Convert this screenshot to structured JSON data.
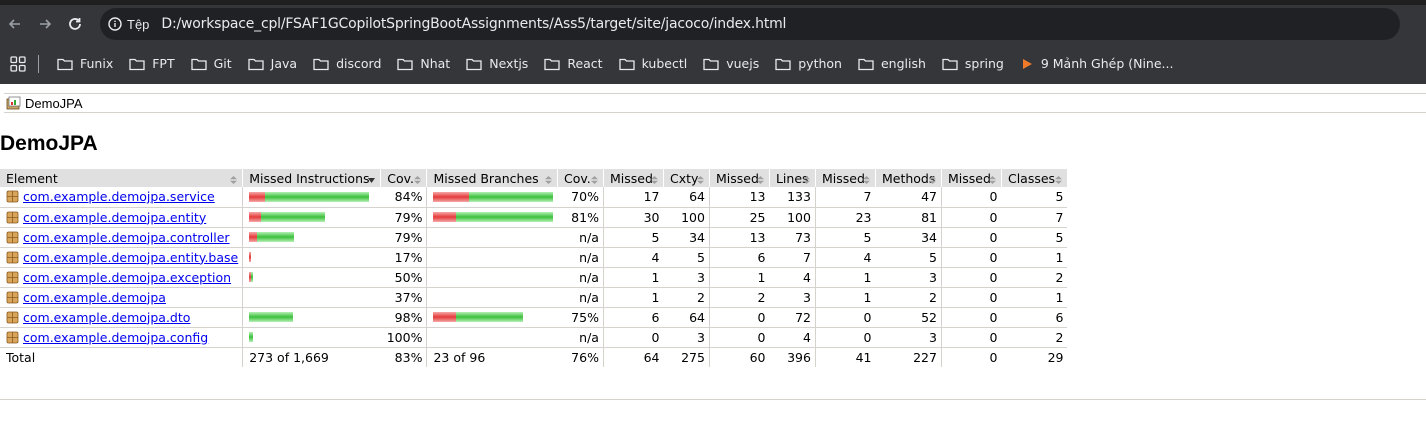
{
  "browser": {
    "scheme_label": "Tệp",
    "url": "D:/workspace_cpl/FSAF1GCopilotSpringBootAssignments/Ass5/target/site/jacoco/index.html",
    "bookmarks": [
      "Funix",
      "FPT",
      "Git",
      "Java",
      "discord",
      "Nhat",
      "Nextjs",
      "React",
      "kubectl",
      "vuejs",
      "python",
      "english",
      "spring",
      "9 Mảnh Ghép (Nine..."
    ]
  },
  "page": {
    "breadcrumb": "DemoJPA",
    "title": "DemoJPA"
  },
  "table": {
    "headers": [
      "Element",
      "Missed Instructions",
      "Cov.",
      "Missed Branches",
      "Cov.",
      "Missed",
      "Cxty",
      "Missed",
      "Lines",
      "Missed",
      "Methods",
      "Missed",
      "Classes"
    ],
    "rows": [
      {
        "name": "com.example.demojpa.service",
        "instr_missed_frac": 0.13,
        "instr_covered_frac": 0.87,
        "instr_cov": "84%",
        "br_missed_frac": 0.3,
        "br_covered_frac": 0.7,
        "br_cov": "70%",
        "cx_missed": "17",
        "cxty": "64",
        "lines_missed": "13",
        "lines": "133",
        "meth_missed": "7",
        "methods": "47",
        "cls_missed": "0",
        "classes": "5"
      },
      {
        "name": "com.example.demojpa.entity",
        "instr_missed_frac": 0.1,
        "instr_covered_frac": 0.53,
        "instr_cov": "79%",
        "br_missed_frac": 0.19,
        "br_covered_frac": 0.81,
        "br_cov": "81%",
        "cx_missed": "30",
        "cxty": "100",
        "lines_missed": "25",
        "lines": "100",
        "meth_missed": "23",
        "methods": "81",
        "cls_missed": "0",
        "classes": "7"
      },
      {
        "name": "com.example.demojpa.controller",
        "instr_missed_frac": 0.07,
        "instr_covered_frac": 0.31,
        "instr_cov": "79%",
        "br_cov": "n/a",
        "cx_missed": "5",
        "cxty": "34",
        "lines_missed": "13",
        "lines": "73",
        "meth_missed": "5",
        "methods": "34",
        "cls_missed": "0",
        "classes": "5"
      },
      {
        "name": "com.example.demojpa.entity.base",
        "instr_missed_frac": 0.015,
        "instr_covered_frac": 0.0,
        "instr_cov": "17%",
        "br_cov": "n/a",
        "cx_missed": "4",
        "cxty": "5",
        "lines_missed": "6",
        "lines": "7",
        "meth_missed": "4",
        "methods": "5",
        "cls_missed": "0",
        "classes": "1"
      },
      {
        "name": "com.example.demojpa.exception",
        "instr_missed_frac": 0.008,
        "instr_covered_frac": 0.007,
        "instr_cov": "50%",
        "br_cov": "n/a",
        "cx_missed": "1",
        "cxty": "3",
        "lines_missed": "1",
        "lines": "4",
        "meth_missed": "1",
        "methods": "3",
        "cls_missed": "0",
        "classes": "2"
      },
      {
        "name": "com.example.demojpa",
        "instr_missed_frac": 0.0,
        "instr_covered_frac": 0.0,
        "instr_cov": "37%",
        "br_cov": "n/a",
        "cx_missed": "1",
        "cxty": "2",
        "lines_missed": "2",
        "lines": "3",
        "meth_missed": "1",
        "methods": "2",
        "cls_missed": "0",
        "classes": "1"
      },
      {
        "name": "com.example.demojpa.dto",
        "instr_missed_frac": 0.0,
        "instr_covered_frac": 0.37,
        "instr_cov": "98%",
        "br_missed_frac": 0.19,
        "br_covered_frac": 0.56,
        "br_cov": "75%",
        "cx_missed": "6",
        "cxty": "64",
        "lines_missed": "0",
        "lines": "72",
        "meth_missed": "0",
        "methods": "52",
        "cls_missed": "0",
        "classes": "6"
      },
      {
        "name": "com.example.demojpa.config",
        "instr_missed_frac": 0.0,
        "instr_covered_frac": 0.03,
        "instr_cov": "100%",
        "br_cov": "n/a",
        "cx_missed": "0",
        "cxty": "3",
        "lines_missed": "0",
        "lines": "4",
        "meth_missed": "0",
        "methods": "3",
        "cls_missed": "0",
        "classes": "2"
      }
    ],
    "total": {
      "label": "Total",
      "instr": "273 of 1,669",
      "instr_cov": "83%",
      "br": "23 of 96",
      "br_cov": "76%",
      "cx_missed": "64",
      "cxty": "275",
      "lines_missed": "60",
      "lines": "396",
      "meth_missed": "41",
      "methods": "227",
      "cls_missed": "0",
      "classes": "29"
    }
  },
  "colors": {
    "missed": "#e43b3b",
    "covered": "#3cbf3c",
    "header_bg": "#e0e0e0"
  }
}
